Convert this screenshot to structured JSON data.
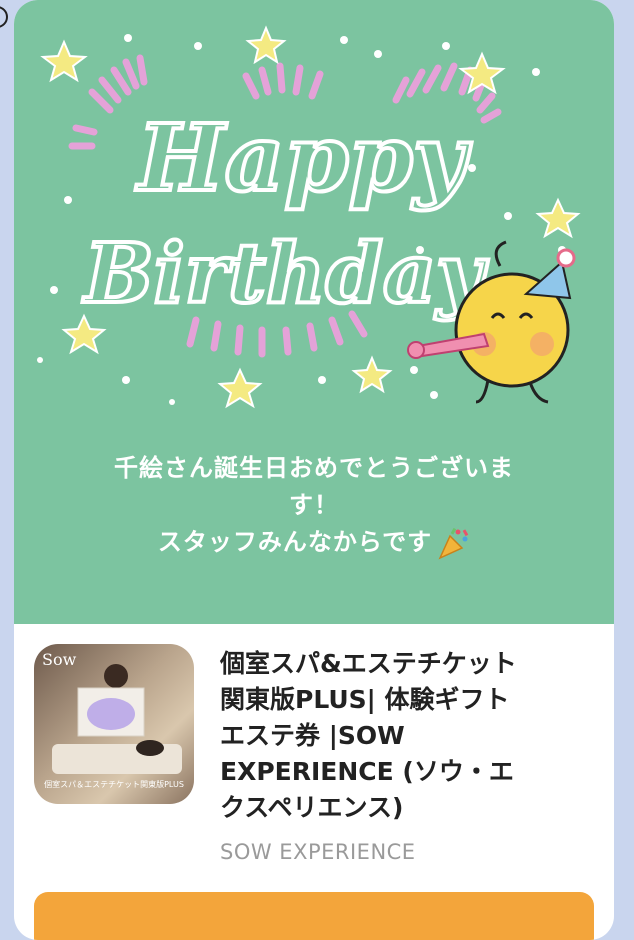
{
  "colors": {
    "page_background": "#c9d5ee",
    "card_green": "#7cc4a0",
    "chalk_white": "#ffffff",
    "chalk_pink": "#e4a2d8",
    "star_yellow": "#f4ea82",
    "cta_orange": "#f3a53b"
  },
  "card": {
    "artwork": {
      "headline_line1": "Happy",
      "headline_line2": "Birthday",
      "character_icon": "party-emoji-character-icon",
      "decoration_icons": [
        "star-icon",
        "confetti-dot-icon",
        "party-hat-icon",
        "party-blower-icon"
      ]
    },
    "message": {
      "lines": [
        "千絵さん誕生日おめでとうございま",
        "す！",
        "スタッフみんなからです"
      ],
      "trailing_icon": "party-popper-icon"
    }
  },
  "gift": {
    "thumbnail": {
      "brand": "Sow",
      "caption": "個室スパ＆エステチケット関東版PLUS"
    },
    "title_lines": [
      "個室スパ&エステチケット",
      "関東版PLUS| 体験ギフト",
      "エステ券 |SOW",
      "EXPERIENCE (ソウ・エ",
      "クスペリエンス)"
    ],
    "brand": "SOW EXPERIENCE"
  }
}
